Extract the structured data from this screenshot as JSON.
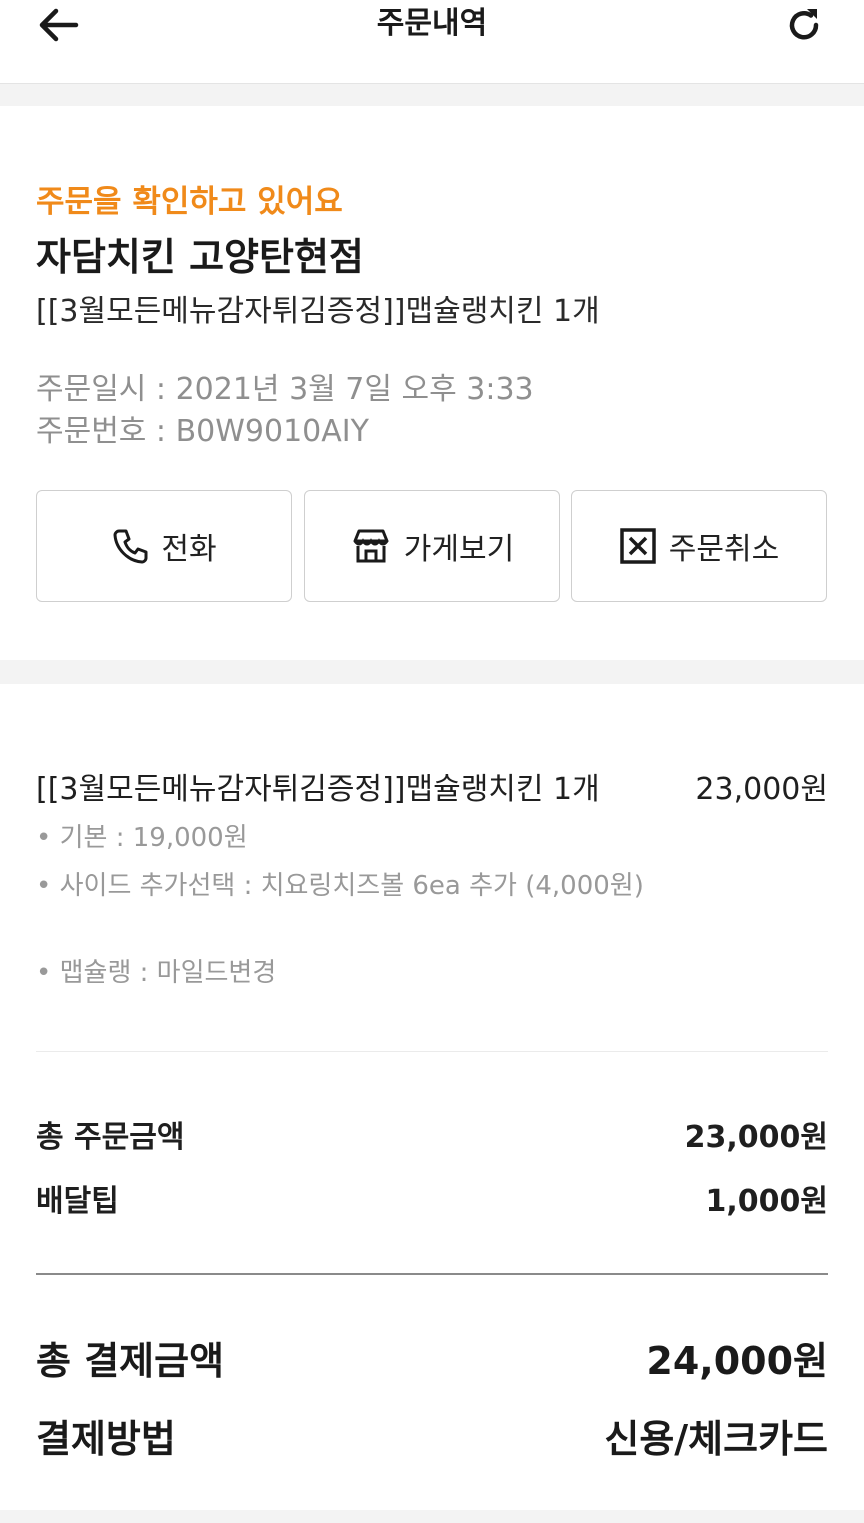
{
  "header": {
    "title": "주문내역",
    "back_icon": "arrow-left-icon",
    "refresh_icon": "refresh-icon"
  },
  "order": {
    "status": "주문을 확인하고 있어요",
    "status_color": "#f08a1a",
    "store_name": "자담치킨 고양탄현점",
    "summary": "[[3월모든메뉴감자튀김증정]]맵슐랭치킨 1개",
    "date": "주문일시 : 2021년 3월 7일 오후 3:33",
    "number": "주문번호 : B0W9010AIY"
  },
  "actions": [
    {
      "label": "전화",
      "icon": "phone-icon"
    },
    {
      "label": "가게보기",
      "icon": "store-icon"
    },
    {
      "label": "주문취소",
      "icon": "cancel-box-icon"
    }
  ],
  "item": {
    "name": "[[3월모든메뉴감자튀김증정]]맵슐랭치킨 1개",
    "price": "23,000원",
    "options": [
      "• 기본 : 19,000원",
      "• 사이드 추가선택 : 치요링치즈볼 6ea 추가 (4,000원)",
      "• 맵슐랭 : 마일드변경"
    ]
  },
  "totals": {
    "order_amount_label": "총 주문금액",
    "order_amount": "23,000원",
    "delivery_tip_label": "배달팁",
    "delivery_tip": "1,000원",
    "payment_total_label": "총 결제금액",
    "payment_total": "24,000원",
    "payment_method_label": "결제방법",
    "payment_method": "신용/체크카드"
  }
}
